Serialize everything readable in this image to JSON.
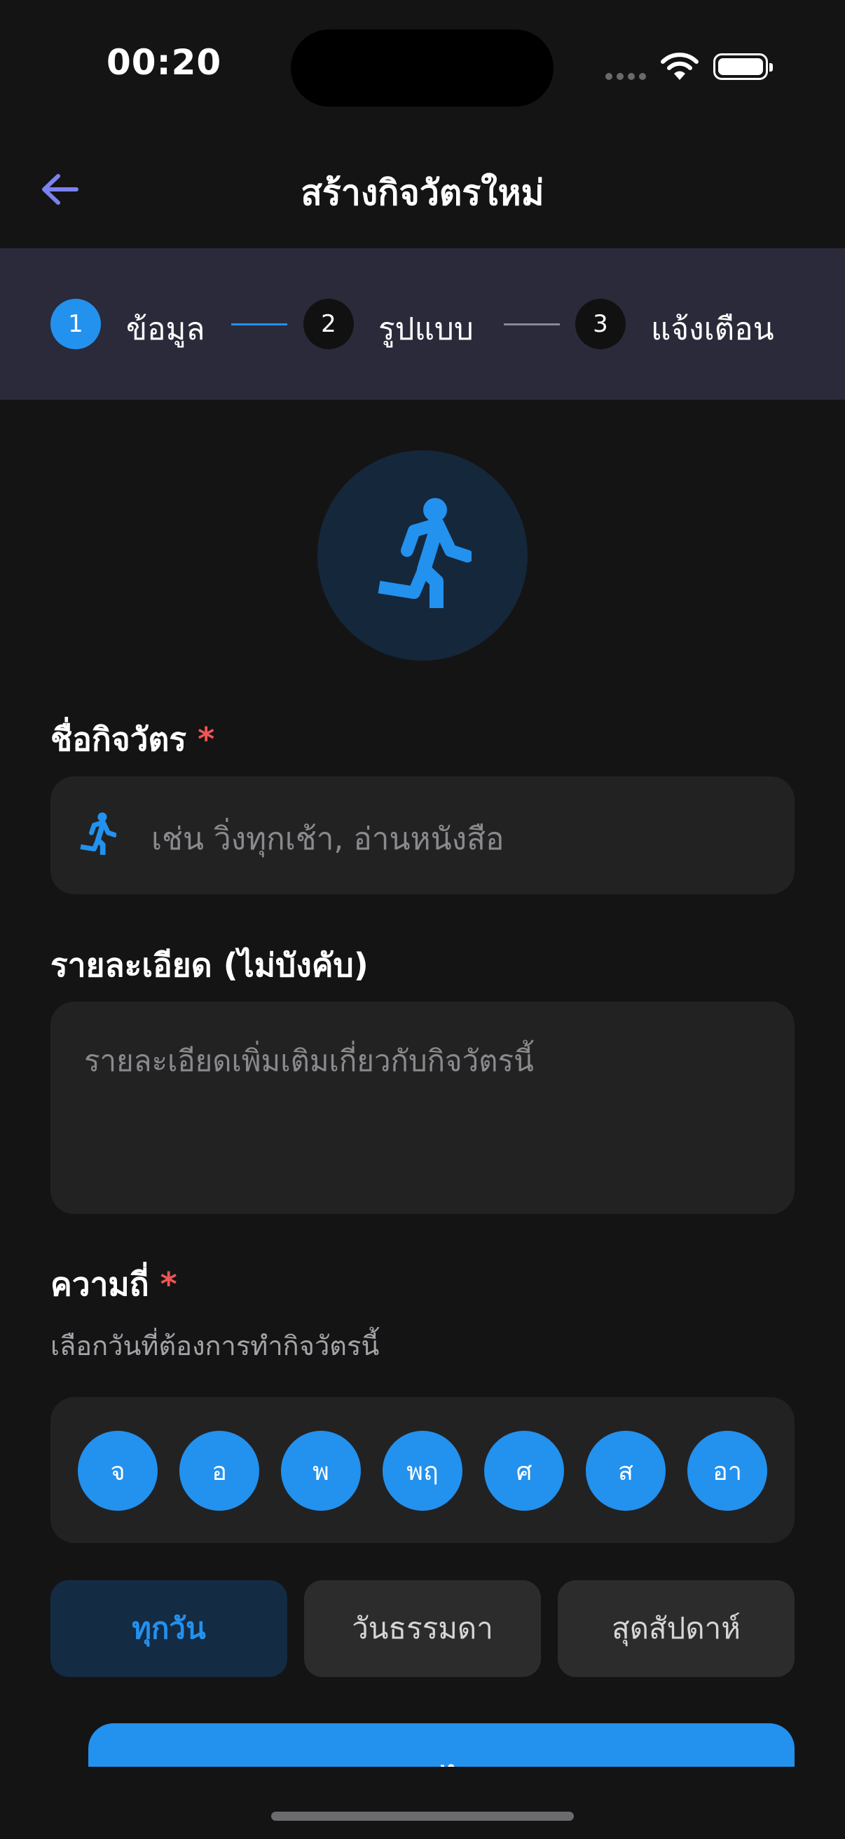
{
  "status_bar": {
    "time": "00:20"
  },
  "header": {
    "title": "สร้างกิจวัตรใหม่"
  },
  "stepper": {
    "steps": [
      {
        "number": "1",
        "label": "ข้อมูล"
      },
      {
        "number": "2",
        "label": "รูปแบบ"
      },
      {
        "number": "3",
        "label": "แจ้งเตือน"
      }
    ]
  },
  "form": {
    "name_label": "ชื่อกิจวัตร",
    "required_mark": "*",
    "name_placeholder": "เช่น วิ่งทุกเช้า, อ่านหนังสือ",
    "description_label": "รายละเอียด (ไม่บังคับ)",
    "description_placeholder": "รายละเอียดเพิ่มเติมเกี่ยวกับกิจวัตรนี้",
    "frequency_label": "ความถี่",
    "frequency_hint": "เลือกวันที่ต้องการทำกิจวัตรนี้",
    "days": [
      "จ",
      "อ",
      "พ",
      "พฤ",
      "ศ",
      "ส",
      "อา"
    ],
    "presets": {
      "everyday": "ทุกวัน",
      "weekdays": "วันธรรมดา",
      "weekends": "สุดสัปดาห์"
    }
  },
  "footer": {
    "next_label": "ถัดไป"
  },
  "colors": {
    "accent": "#2391ee",
    "background": "#141415",
    "stepper_bg": "#2a2a3a",
    "required": "#f05454"
  },
  "icons": {
    "back": "arrow-left-icon",
    "habit": "running-person-icon"
  }
}
